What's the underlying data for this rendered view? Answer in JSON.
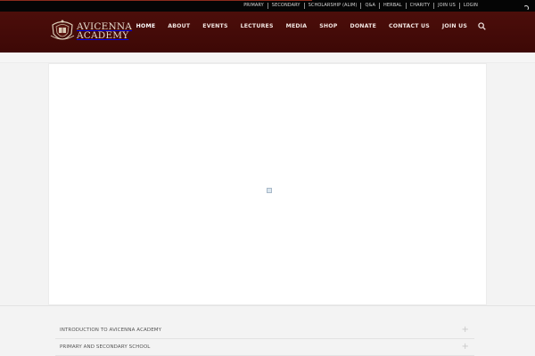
{
  "topbar": {
    "links": [
      "PRIMARY",
      "SECONDARY",
      "SCHOLARSHIP (ALIM)",
      "Q&A",
      "HERBAL",
      "CHARITY",
      "JOIN US",
      "LOGIN"
    ]
  },
  "brand": {
    "line1": "AVICENNA",
    "line2": "ACADEMY",
    "colors": {
      "header": "#430b08",
      "topbar": "#050505",
      "logo_text": "#e6dccd"
    }
  },
  "nav": {
    "items": [
      "HOME",
      "ABOUT",
      "EVENTS",
      "LECTURES",
      "MEDIA",
      "SHOP",
      "DONATE",
      "CONTACT US",
      "JOIN US"
    ],
    "active": "HOME",
    "search_icon": "search-icon"
  },
  "main": {
    "image_placeholder_icon": "broken-image-icon"
  },
  "accordion": {
    "items": [
      "INTRODUCTION TO AVICENNA ACADEMY",
      "PRIMARY AND SECONDARY SCHOOL"
    ],
    "expand_icon": "plus-icon"
  }
}
